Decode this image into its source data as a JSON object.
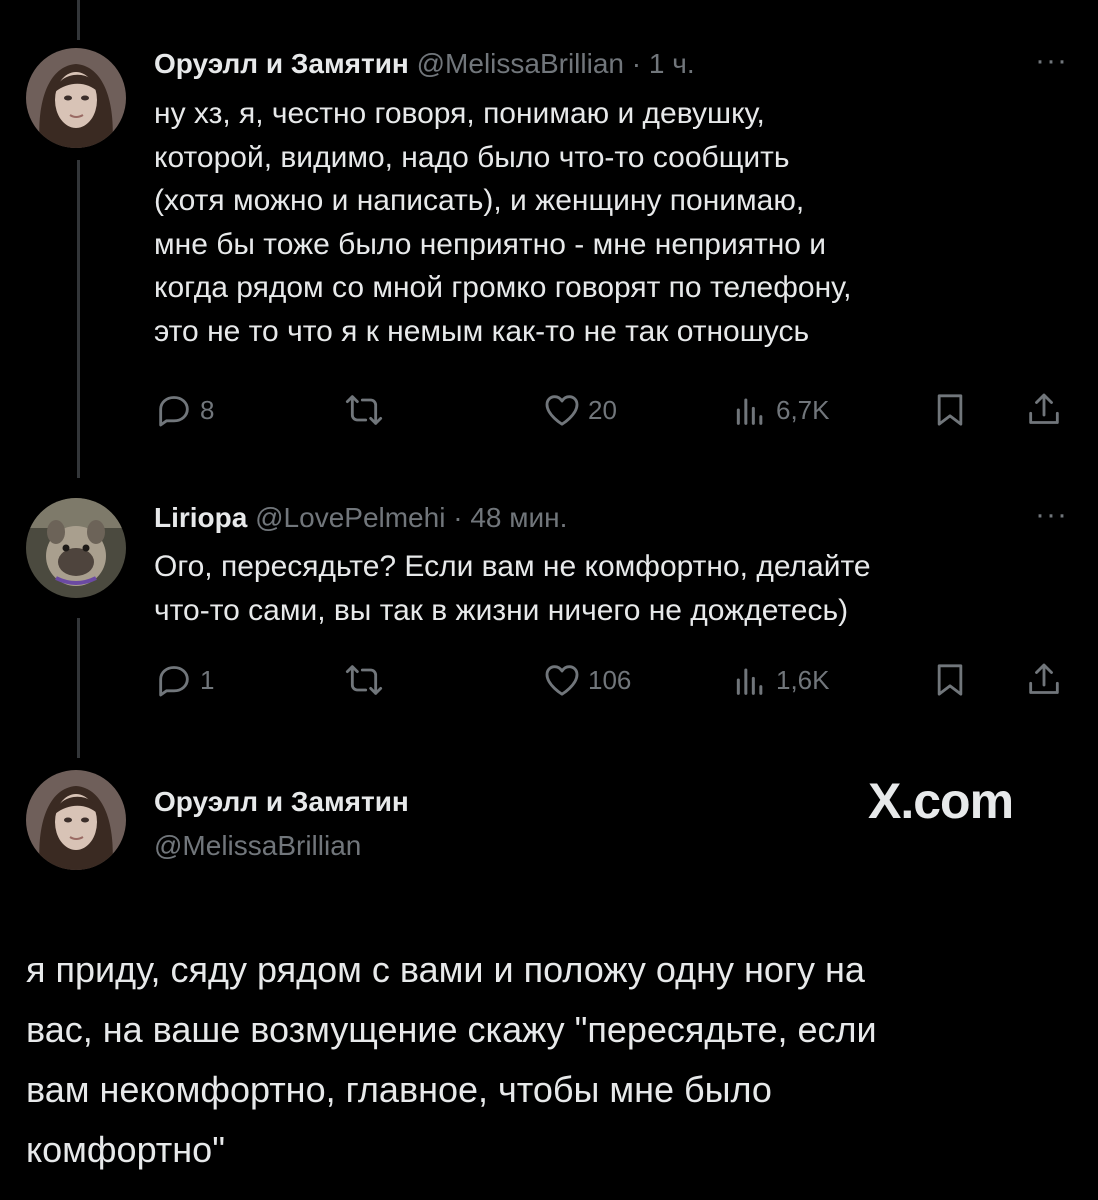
{
  "tweets": [
    {
      "name": "Оруэлл и Замятин",
      "handle": "@MelissaBrillian",
      "sep": "·",
      "time": "1 ч.",
      "more": "···",
      "text": "ну хз, я, честно говоря, понимаю и девушку,\nкоторой, видимо, надо было что-то сообщить\n(хотя можно и написать), и женщину понимаю,\nмне бы тоже было неприятно - мне неприятно и\nкогда рядом со мной громко говорят по телефону,\nэто не то что я к немым как-то не так отношусь",
      "replies": "8",
      "likes": "20",
      "views": "6,7K"
    },
    {
      "name": "Liriopa",
      "handle": "@LovePelmehi",
      "sep": "·",
      "time": "48 мин.",
      "more": "···",
      "text": "Ого, пересядьте? Если вам не комфортно, делайте\nчто-то сами, вы так в жизни ничего не дождетесь)",
      "replies": "1",
      "likes": "106",
      "views": "1,6K"
    }
  ],
  "main_tweet": {
    "name": "Оруэлл и Замятин",
    "handle": "@MelissaBrillian",
    "text": "я приду, сяду рядом с вами и положу одну ногу на\nвас, на ваше возмущение скажу \"пересядьте, если\nвам некомфортно, главное, чтобы мне было\nкомфортно\""
  },
  "watermark": "X.com",
  "icons": [
    "reply-icon",
    "retweet-icon",
    "like-icon",
    "views-icon",
    "bookmark-icon",
    "share-icon"
  ],
  "colors": {
    "background": "#000000",
    "text": "#e7e9ea",
    "muted": "#71767b",
    "thread_line": "#333639"
  }
}
